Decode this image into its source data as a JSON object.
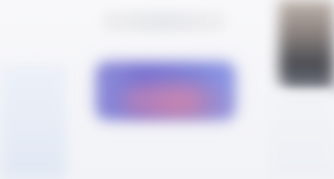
{
  "colors": {
    "background": "#f4f5f8",
    "left_panel": "#e4eaf5",
    "top_heading": "#e8e9ec",
    "primary_button": "#7e83d9",
    "button_glow": "#d580a2",
    "thumbnail": "#4a4c52",
    "right_panel": "#eef1f5"
  }
}
